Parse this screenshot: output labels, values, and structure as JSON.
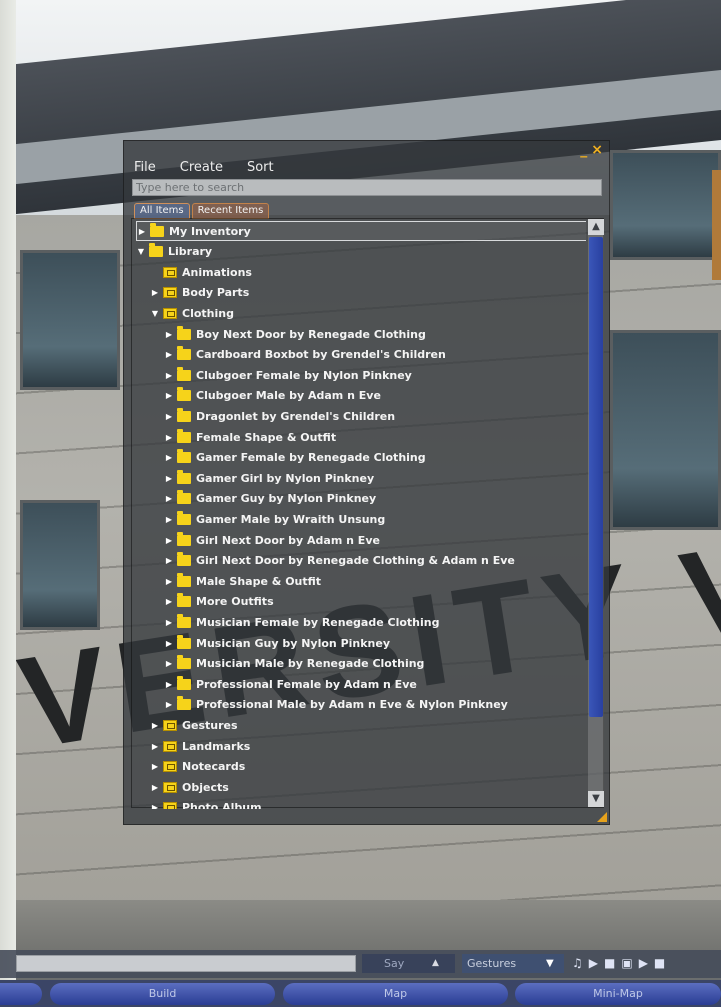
{
  "inventory": {
    "menu": [
      "File",
      "Create",
      "Sort"
    ],
    "title_buttons": [
      "_",
      "×"
    ],
    "search_placeholder": "Type here to search",
    "tabs": [
      "All Items",
      "Recent Items"
    ],
    "items": [
      {
        "label": "My Inventory",
        "indent": 0,
        "expander": "closed",
        "icon": "folder",
        "selected": true
      },
      {
        "label": "Library",
        "indent": 0,
        "expander": "open",
        "icon": "folder"
      },
      {
        "label": "Animations",
        "indent": 1,
        "expander": "none",
        "icon": "category"
      },
      {
        "label": "Body Parts",
        "indent": 1,
        "expander": "closed",
        "icon": "category"
      },
      {
        "label": "Clothing",
        "indent": 1,
        "expander": "open",
        "icon": "category"
      },
      {
        "label": "Boy Next Door by Renegade Clothing",
        "indent": 2,
        "expander": "closed",
        "icon": "folder"
      },
      {
        "label": "Cardboard Boxbot by Grendel's Children",
        "indent": 2,
        "expander": "closed",
        "icon": "folder"
      },
      {
        "label": "Clubgoer Female by Nylon Pinkney",
        "indent": 2,
        "expander": "closed",
        "icon": "folder"
      },
      {
        "label": "Clubgoer Male by Adam n Eve",
        "indent": 2,
        "expander": "closed",
        "icon": "folder"
      },
      {
        "label": "Dragonlet by Grendel's Children",
        "indent": 2,
        "expander": "closed",
        "icon": "folder"
      },
      {
        "label": "Female Shape & Outfit",
        "indent": 2,
        "expander": "closed",
        "icon": "folder"
      },
      {
        "label": "Gamer Female by Renegade Clothing",
        "indent": 2,
        "expander": "closed",
        "icon": "folder"
      },
      {
        "label": "Gamer Girl by Nylon Pinkney",
        "indent": 2,
        "expander": "closed",
        "icon": "folder"
      },
      {
        "label": "Gamer Guy by Nylon Pinkney",
        "indent": 2,
        "expander": "closed",
        "icon": "folder"
      },
      {
        "label": "Gamer Male by Wraith Unsung",
        "indent": 2,
        "expander": "closed",
        "icon": "folder"
      },
      {
        "label": "Girl Next Door by Adam n Eve",
        "indent": 2,
        "expander": "closed",
        "icon": "folder"
      },
      {
        "label": "Girl Next Door by Renegade Clothing & Adam n Eve",
        "indent": 2,
        "expander": "closed",
        "icon": "folder"
      },
      {
        "label": "Male Shape & Outfit",
        "indent": 2,
        "expander": "closed",
        "icon": "folder"
      },
      {
        "label": "More Outfits",
        "indent": 2,
        "expander": "closed",
        "icon": "folder"
      },
      {
        "label": "Musician Female by Renegade Clothing",
        "indent": 2,
        "expander": "closed",
        "icon": "folder"
      },
      {
        "label": "Musician Guy by Nylon Pinkney",
        "indent": 2,
        "expander": "closed",
        "icon": "folder"
      },
      {
        "label": "Musician Male by Renegade Clothing",
        "indent": 2,
        "expander": "closed",
        "icon": "folder"
      },
      {
        "label": "Professional Female by Adam n Eve",
        "indent": 2,
        "expander": "closed",
        "icon": "folder"
      },
      {
        "label": "Professional Male by Adam n Eve & Nylon Pinkney",
        "indent": 2,
        "expander": "closed",
        "icon": "folder"
      },
      {
        "label": "Gestures",
        "indent": 1,
        "expander": "closed",
        "icon": "category"
      },
      {
        "label": "Landmarks",
        "indent": 1,
        "expander": "closed",
        "icon": "category"
      },
      {
        "label": "Notecards",
        "indent": 1,
        "expander": "closed",
        "icon": "category"
      },
      {
        "label": "Objects",
        "indent": 1,
        "expander": "closed",
        "icon": "category"
      },
      {
        "label": "Photo Album",
        "indent": 1,
        "expander": "closed",
        "icon": "category"
      }
    ]
  },
  "scene": {
    "sign_letters": "VERSITY V"
  },
  "chat": {
    "say_label": "Say",
    "gestures_label": "Gestures"
  },
  "toolbar": {
    "build_label": "Build",
    "map_label": "Map",
    "minimap_label": "Mini-Map"
  },
  "icons": {
    "folder": "folder-icon",
    "category": "category-folder-icon",
    "media": [
      "music-note-icon",
      "play-icon",
      "stop-icon",
      "movie-icon",
      "play-icon",
      "stop-icon"
    ]
  },
  "colors": {
    "folder_yellow": "#f6d31a",
    "scroll_thumb": "#3a56b8",
    "floater_bg": "#34383c",
    "title_accent": "#f0b020"
  }
}
